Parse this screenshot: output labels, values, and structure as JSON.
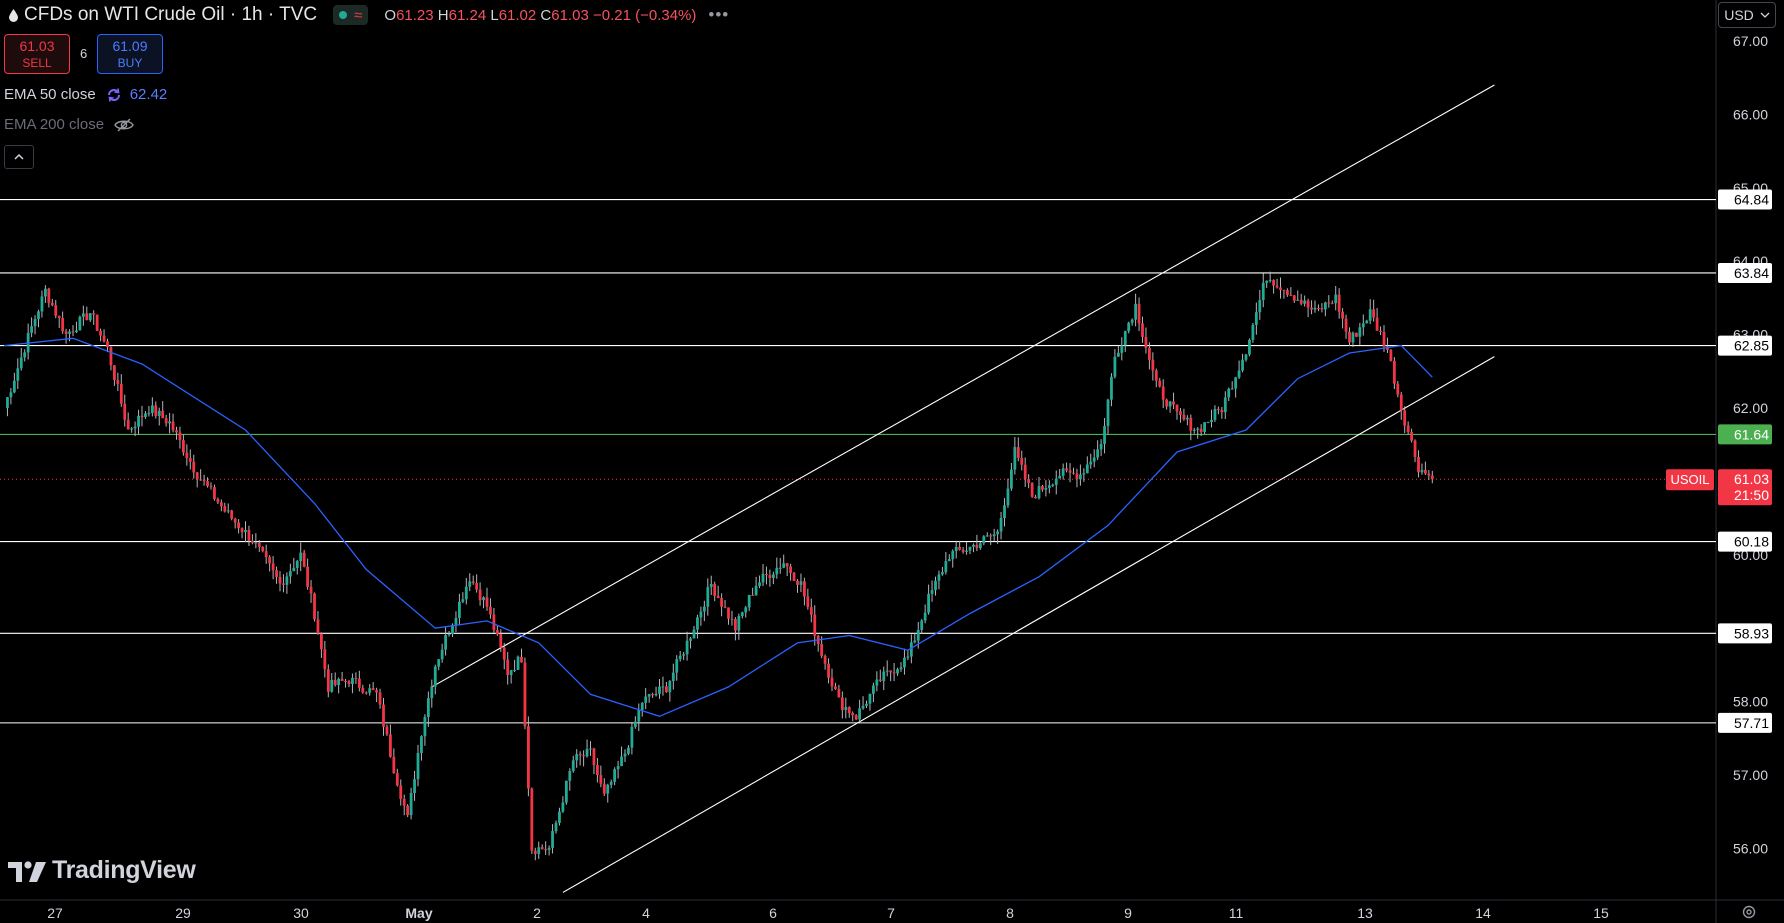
{
  "header": {
    "title": "CFDs on WTI Crude Oil · 1h · TVC",
    "ohlc": {
      "o_label": "O",
      "o": "61.23",
      "h_label": "H",
      "h": "61.24",
      "l_label": "L",
      "l": "61.02",
      "c_label": "C",
      "c": "61.03",
      "change": "−0.21 (−0.34%)"
    }
  },
  "trade": {
    "sell_price": "61.03",
    "sell_label": "SELL",
    "spread": "6",
    "buy_price": "61.09",
    "buy_label": "BUY"
  },
  "indicators": [
    {
      "label": "EMA 50 close",
      "value": "62.42",
      "icon": "refresh-icon"
    },
    {
      "label": "EMA 200 close",
      "icon": "eye-off-icon"
    }
  ],
  "currency": "USD",
  "brand": "TradingView",
  "colors": {
    "up": "#22ab94",
    "down": "#f23645",
    "ema": "#2962ff",
    "background": "#000000"
  },
  "chart_data": {
    "type": "candlestick",
    "symbol": "USOIL",
    "timeframe": "1h",
    "ylim": [
      55.3,
      67.2
    ],
    "y_ticks": [
      "56.00",
      "57.00",
      "58.00",
      "59.00",
      "60.00",
      "61.00",
      "62.00",
      "63.00",
      "64.00",
      "65.00",
      "66.00",
      "67.00"
    ],
    "x_tick_labels": [
      "27",
      "29",
      "30",
      "May",
      "2",
      "4",
      "6",
      "7",
      "8",
      "9",
      "11",
      "13",
      "14",
      "15"
    ],
    "last_price": "61.03",
    "countdown": "21:50",
    "horizontal_levels": [
      {
        "value": 64.84,
        "label": "64.84",
        "color": "#ffffff"
      },
      {
        "value": 63.84,
        "label": "63.84",
        "color": "#ffffff"
      },
      {
        "value": 62.85,
        "label": "62.85",
        "color": "#ffffff"
      },
      {
        "value": 61.64,
        "label": "61.64",
        "color": "#4caf50"
      },
      {
        "value": 60.18,
        "label": "60.18",
        "color": "#ffffff"
      },
      {
        "value": 58.93,
        "label": "58.93",
        "color": "#ffffff"
      },
      {
        "value": 57.71,
        "label": "57.71",
        "color": "#ffffff"
      }
    ],
    "close_path": [
      {
        "i": 0,
        "c": 62.0
      },
      {
        "i": 8,
        "c": 63.1
      },
      {
        "i": 12,
        "c": 63.6
      },
      {
        "i": 18,
        "c": 63.0
      },
      {
        "i": 25,
        "c": 63.3
      },
      {
        "i": 30,
        "c": 62.8
      },
      {
        "i": 36,
        "c": 61.7
      },
      {
        "i": 42,
        "c": 62.0
      },
      {
        "i": 48,
        "c": 61.8
      },
      {
        "i": 56,
        "c": 61.1
      },
      {
        "i": 64,
        "c": 60.6
      },
      {
        "i": 72,
        "c": 60.2
      },
      {
        "i": 80,
        "c": 59.6
      },
      {
        "i": 86,
        "c": 60.0
      },
      {
        "i": 90,
        "c": 59.2
      },
      {
        "i": 94,
        "c": 58.2
      },
      {
        "i": 100,
        "c": 58.3
      },
      {
        "i": 108,
        "c": 58.1
      },
      {
        "i": 113,
        "c": 57.1
      },
      {
        "i": 117,
        "c": 56.4
      },
      {
        "i": 121,
        "c": 57.6
      },
      {
        "i": 125,
        "c": 58.5
      },
      {
        "i": 130,
        "c": 59.1
      },
      {
        "i": 135,
        "c": 59.7
      },
      {
        "i": 140,
        "c": 59.3
      },
      {
        "i": 146,
        "c": 58.4
      },
      {
        "i": 150,
        "c": 58.6
      },
      {
        "i": 153,
        "c": 56.0
      },
      {
        "i": 158,
        "c": 56.0
      },
      {
        "i": 165,
        "c": 57.2
      },
      {
        "i": 170,
        "c": 57.3
      },
      {
        "i": 174,
        "c": 56.7
      },
      {
        "i": 180,
        "c": 57.3
      },
      {
        "i": 185,
        "c": 58.0
      },
      {
        "i": 192,
        "c": 58.2
      },
      {
        "i": 198,
        "c": 58.8
      },
      {
        "i": 205,
        "c": 59.6
      },
      {
        "i": 212,
        "c": 59.0
      },
      {
        "i": 218,
        "c": 59.6
      },
      {
        "i": 226,
        "c": 59.9
      },
      {
        "i": 231,
        "c": 59.6
      },
      {
        "i": 236,
        "c": 58.8
      },
      {
        "i": 242,
        "c": 58.0
      },
      {
        "i": 247,
        "c": 57.8
      },
      {
        "i": 254,
        "c": 58.3
      },
      {
        "i": 262,
        "c": 58.6
      },
      {
        "i": 268,
        "c": 59.4
      },
      {
        "i": 274,
        "c": 60.0
      },
      {
        "i": 280,
        "c": 60.1
      },
      {
        "i": 288,
        "c": 60.3
      },
      {
        "i": 293,
        "c": 61.4
      },
      {
        "i": 298,
        "c": 60.8
      },
      {
        "i": 306,
        "c": 61.1
      },
      {
        "i": 312,
        "c": 61.1
      },
      {
        "i": 318,
        "c": 61.5
      },
      {
        "i": 322,
        "c": 62.7
      },
      {
        "i": 328,
        "c": 63.4
      },
      {
        "i": 334,
        "c": 62.3
      },
      {
        "i": 340,
        "c": 61.9
      },
      {
        "i": 346,
        "c": 61.7
      },
      {
        "i": 353,
        "c": 62.0
      },
      {
        "i": 360,
        "c": 62.8
      },
      {
        "i": 366,
        "c": 63.8
      },
      {
        "i": 372,
        "c": 63.6
      },
      {
        "i": 380,
        "c": 63.3
      },
      {
        "i": 386,
        "c": 63.5
      },
      {
        "i": 390,
        "c": 62.9
      },
      {
        "i": 396,
        "c": 63.3
      },
      {
        "i": 401,
        "c": 62.8
      },
      {
        "i": 405,
        "c": 62.0
      },
      {
        "i": 410,
        "c": 61.2
      },
      {
        "i": 414,
        "c": 61.03
      }
    ],
    "ema_path": [
      {
        "i": 0,
        "v": 62.85
      },
      {
        "i": 20,
        "v": 62.95
      },
      {
        "i": 40,
        "v": 62.6
      },
      {
        "i": 70,
        "v": 61.7
      },
      {
        "i": 90,
        "v": 60.7
      },
      {
        "i": 105,
        "v": 59.8
      },
      {
        "i": 125,
        "v": 59.0
      },
      {
        "i": 140,
        "v": 59.1
      },
      {
        "i": 155,
        "v": 58.8
      },
      {
        "i": 170,
        "v": 58.1
      },
      {
        "i": 190,
        "v": 57.8
      },
      {
        "i": 210,
        "v": 58.2
      },
      {
        "i": 230,
        "v": 58.8
      },
      {
        "i": 245,
        "v": 58.9
      },
      {
        "i": 262,
        "v": 58.7
      },
      {
        "i": 280,
        "v": 59.2
      },
      {
        "i": 300,
        "v": 59.7
      },
      {
        "i": 320,
        "v": 60.4
      },
      {
        "i": 340,
        "v": 61.4
      },
      {
        "i": 360,
        "v": 61.7
      },
      {
        "i": 375,
        "v": 62.4
      },
      {
        "i": 390,
        "v": 62.75
      },
      {
        "i": 405,
        "v": 62.85
      },
      {
        "i": 414,
        "v": 62.42
      }
    ],
    "trendlines": [
      {
        "from": {
          "i": 124,
          "v": 58.2
        },
        "to": {
          "i": 432,
          "v": 66.4
        }
      },
      {
        "from": {
          "i": 162,
          "v": 55.4
        },
        "to": {
          "i": 432,
          "v": 62.7
        }
      }
    ]
  }
}
